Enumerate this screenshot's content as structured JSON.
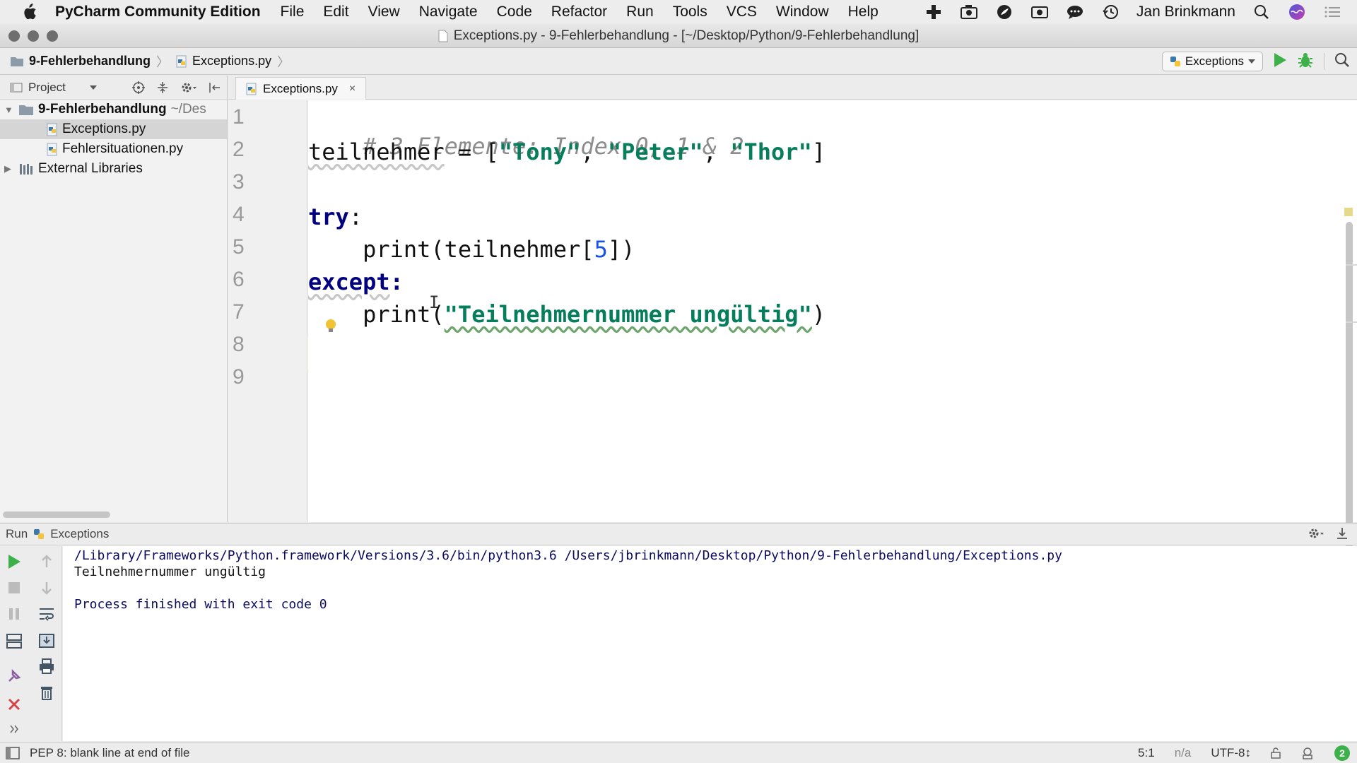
{
  "menubar": {
    "app_name": "PyCharm Community Edition",
    "menus": [
      "File",
      "Edit",
      "View",
      "Navigate",
      "Code",
      "Refactor",
      "Run",
      "Tools",
      "VCS",
      "Window",
      "Help"
    ],
    "user": "Jan Brinkmann",
    "icons": [
      "plus-icon",
      "cam-icon",
      "leaf-icon",
      "video-icon",
      "chat-icon",
      "history-icon",
      "search-icon",
      "siri-icon",
      "list-icon"
    ]
  },
  "window": {
    "title": "Exceptions.py - 9-Fehlerbehandlung - [~/Desktop/Python/9-Fehlerbehandlung]"
  },
  "breadcrumbs": [
    "9-Fehlerbehandlung",
    "Exceptions.py"
  ],
  "run_config": {
    "label": "Exceptions"
  },
  "project": {
    "header_label": "Project",
    "tree": [
      {
        "label": "9-Fehlerbehandlung",
        "extra": "~/Des",
        "type": "folder",
        "expanded": true
      },
      {
        "label": "Exceptions.py",
        "type": "file",
        "selected": true
      },
      {
        "label": "Fehlersituationen.py",
        "type": "file"
      },
      {
        "label": "External Libraries",
        "type": "library",
        "expanded": false
      }
    ]
  },
  "editor": {
    "tab_label": "Exceptions.py",
    "tab_close": "×",
    "line_numbers": [
      "1",
      "2",
      "3",
      "4",
      "5",
      "6",
      "7",
      "8",
      "9"
    ],
    "lines": {
      "l1": "# 3 Elemente: Index 0, 1 & 2",
      "l2_ident": "teilnehmer",
      "l2_eq": " = [",
      "l2_s1": "\"Tony\"",
      "l2_c1": ", ",
      "l2_s2": "\"Peter\"",
      "l2_c2": ", ",
      "l2_s3": "\"Thor\"",
      "l2_end": "]",
      "l4_kw": "try",
      "l4_colon": ":",
      "l5_pre": "    print(teilnehmer[",
      "l5_num": "5",
      "l5_post": "])",
      "l6_kw": "except",
      "l6_colon": ":",
      "l7_pre": "    print(",
      "l7_str": "\"Teilnehmernummer ungültig\"",
      "l7_post": ")"
    }
  },
  "run_panel": {
    "header_label": "Run",
    "config_label": "Exceptions",
    "output": [
      "/Library/Frameworks/Python.framework/Versions/3.6/bin/python3.6 /Users/jbrinkmann/Desktop/Python/9-Fehlerbehandlung/Exceptions.py",
      "Teilnehmernummer ungültig",
      "",
      "Process finished with exit code 0"
    ]
  },
  "statusbar": {
    "message": "PEP 8: blank line at end of file",
    "position": "5:1",
    "na": "n/a",
    "encoding": "UTF-8↕",
    "notifications": "2"
  }
}
